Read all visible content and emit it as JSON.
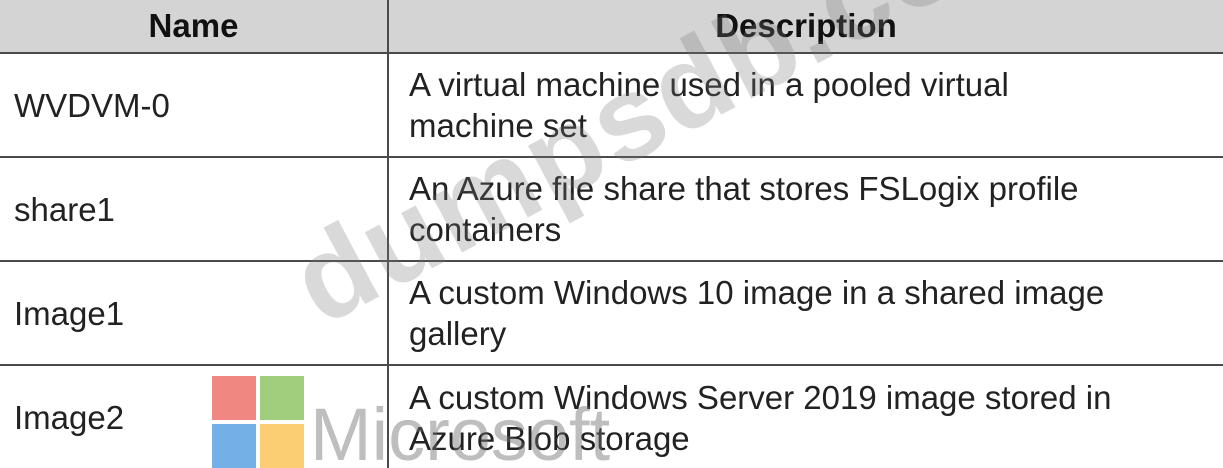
{
  "table": {
    "headers": [
      "Name",
      "Description"
    ],
    "rows": [
      {
        "name": "WVDVM-0",
        "desc_line1": "A virtual machine used in a pooled virtual",
        "desc_line2": "machine set"
      },
      {
        "name": "share1",
        "desc_line1": "An Azure file share that stores FSLogix profile",
        "desc_line2": "containers"
      },
      {
        "name": "Image1",
        "desc_line1": "A custom Windows 10 image in a shared image",
        "desc_line2": "gallery"
      },
      {
        "name": "Image2",
        "desc_line1": "A custom Windows Server 2019 image stored in",
        "desc_line2": "Azure Blob storage"
      }
    ]
  },
  "watermark": {
    "text": "dumpsdb.com",
    "logo_word": "Microsoft",
    "logo_colors": [
      "#f25022",
      "#7fba00",
      "#00a4ef",
      "#ffb900"
    ]
  }
}
